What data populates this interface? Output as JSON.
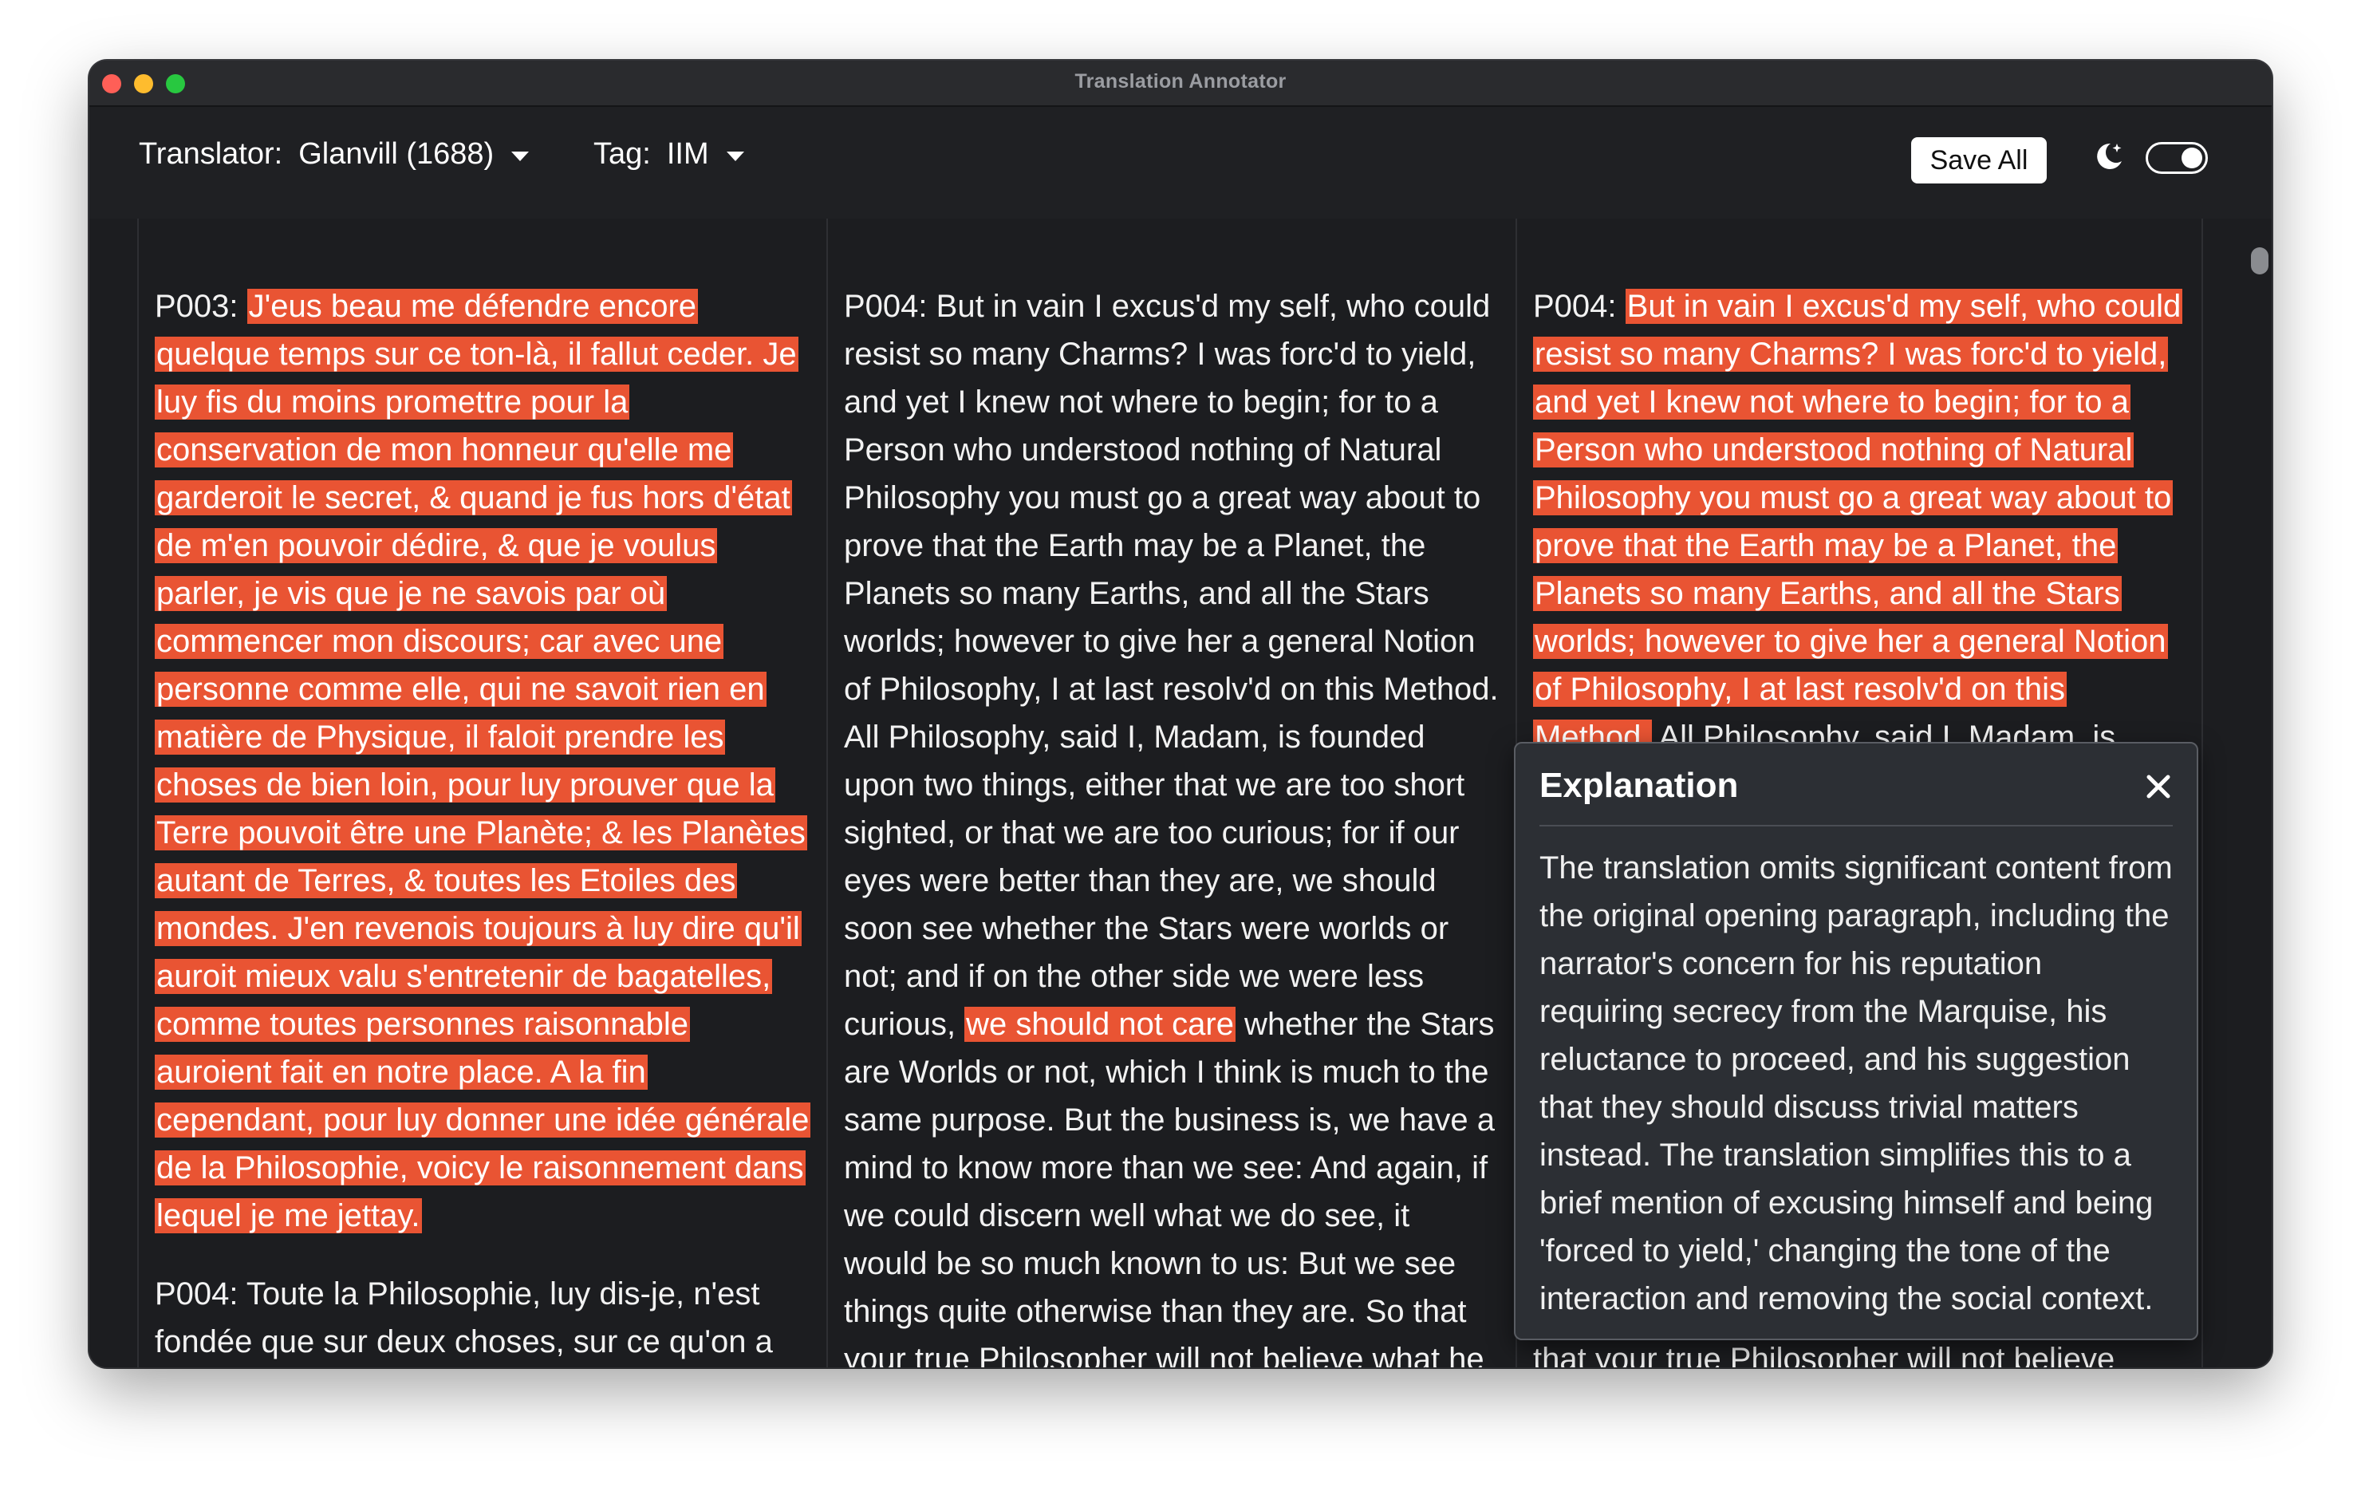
{
  "window": {
    "title": "Translation Annotator"
  },
  "toolbar": {
    "translator_label": "Translator:",
    "translator_value": "Glanvill (1688)",
    "tag_label": "Tag:",
    "tag_value": "IIM",
    "save_label": "Save All",
    "theme_toggle_on": true
  },
  "columns": [
    {
      "paragraphs": [
        {
          "segments": [
            {
              "text": "P003: ",
              "highlight": false
            },
            {
              "text": "J'eus beau me défendre encore quelque temps sur ce ton-là, il fallut ceder. Je luy fis du moins promettre pour la conservation de mon honneur qu'elle me garderoit le secret, & quand je fus hors d'état de m'en pouvoir dédire, & que je voulus parler, je vis que je ne savois par où commencer mon discours; car avec une personne comme elle, qui ne savoit rien en matière de Physique, il faloit prendre les choses de bien loin, pour luy prouver que la Terre pouvoit être une Planète; & les Planètes autant de Terres, & toutes les Etoiles des mondes. J'en revenois toujours à luy dire qu'il auroit mieux valu s'entretenir de bagatelles, comme toutes personnes raisonnable auroient fait en notre place. A la fin cependant, pour luy donner une idée générale de la Philosophie, voicy le raisonnement dans lequel je me jettay.",
              "highlight": true
            }
          ]
        },
        {
          "segments": [
            {
              "text": "P004: Toute la Philosophie, luy dis-je, n'est fondée que sur deux choses, sur ce qu'on a",
              "highlight": false
            }
          ]
        }
      ]
    },
    {
      "paragraphs": [
        {
          "segments": [
            {
              "text": "P004: But in vain I excus'd my self, who could resist so many Charms? I was forc'd to yield, and yet I knew not where to begin; for to a Person who understood nothing of Natural Philosophy you must go a great way about to prove that the Earth may be a Planet, the Planets so many Earths, and all the Stars worlds; however to give her a general Notion of Philosophy, I at last resolv'd on this Method. All Philosophy, said I, Madam, is founded upon two things, either that we are too short sighted, or that we are too curious; for if our eyes were better than they are, we should soon see whether the Stars were worlds or not; and if on the other side we were less curious, ",
              "highlight": false
            },
            {
              "text": "we should not care",
              "highlight": true
            },
            {
              "text": " whether the Stars are Worlds or not, which I think is much to the same purpose. But the business is, we have a mind to know more than we see: And again, if we could discern well what we do see, it would be so much known to us: But we see things quite otherwise than they are. So that your true Philosopher will not believe what he",
              "highlight": false
            }
          ]
        }
      ]
    },
    {
      "paragraphs": [
        {
          "segments": [
            {
              "text": "P004: ",
              "highlight": false
            },
            {
              "text": "But in vain I excus'd my self, who could resist so many Charms? I was forc'd to yield, and yet I knew not where to begin; for to a Person who understood nothing of Natural Philosophy you must go a great way about to prove that the Earth may be a Planet, the Planets so many Earths, and all the Stars worlds; however to give her a general Notion of Philosophy, I at last resolv'd on this Method.",
              "highlight": true
            },
            {
              "text": " All Philosophy, said I, Madam, is founded upon two things, either that we are too short sighted, or that we are too curious; for if our eyes were better than they are, we should soon see whether the Stars were worlds or not; and if on the other side we were less curious, we should not care whether the Stars are Worlds or not, which I think is much to the same purpose. But the business is, we have a mind to know more than we see: And again, if we could discern well what we do see, it would be so much known to us: But we see things quite otherwise than they are. So that your true Philosopher will not believe what he",
              "highlight": false
            }
          ]
        }
      ]
    }
  ],
  "popover": {
    "title": "Explanation",
    "body": "The translation omits significant content from the original opening paragraph, including the narrator's concern for his reputation requiring secrecy from the Marquise, his reluctance to proceed, and his suggestion that they should discuss trivial matters instead. The translation simplifies this to a brief mention of excusing himself and being 'forced to yield,' changing the tone of the interaction and removing the social context."
  },
  "colors": {
    "highlight": "#e95433",
    "background": "#1c1d20",
    "toolbar": "#1f2023",
    "popover": "#2c2f34"
  },
  "icons": [
    "moon-icon",
    "close-icon",
    "chevron-down-icon"
  ]
}
